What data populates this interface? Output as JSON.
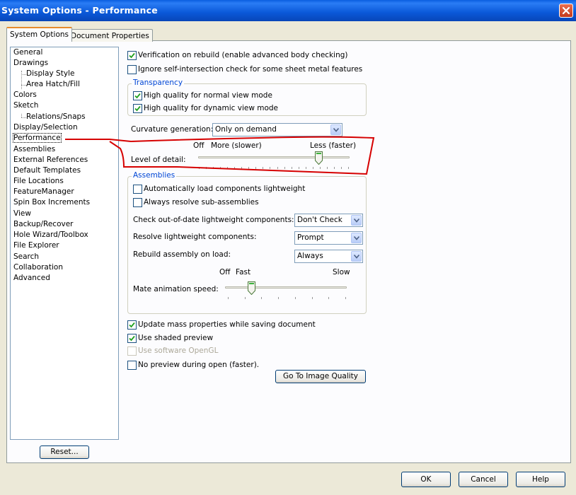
{
  "window": {
    "title": "System Options - Performance"
  },
  "tabs": [
    {
      "label": "System Options",
      "active": true
    },
    {
      "label": "Document Properties",
      "active": false
    }
  ],
  "tree": {
    "items": [
      {
        "label": "General",
        "level": 0
      },
      {
        "label": "Drawings",
        "level": 0
      },
      {
        "label": "Display Style",
        "level": 1
      },
      {
        "label": "Area Hatch/Fill",
        "level": 1
      },
      {
        "label": "Colors",
        "level": 0
      },
      {
        "label": "Sketch",
        "level": 0
      },
      {
        "label": "Relations/Snaps",
        "level": 1
      },
      {
        "label": "Display/Selection",
        "level": 0
      },
      {
        "label": "Performance",
        "level": 0,
        "selected": true
      },
      {
        "label": "Assemblies",
        "level": 0
      },
      {
        "label": "External References",
        "level": 0
      },
      {
        "label": "Default Templates",
        "level": 0
      },
      {
        "label": "File Locations",
        "level": 0
      },
      {
        "label": "FeatureManager",
        "level": 0
      },
      {
        "label": "Spin Box Increments",
        "level": 0
      },
      {
        "label": "View",
        "level": 0
      },
      {
        "label": "Backup/Recover",
        "level": 0
      },
      {
        "label": "Hole Wizard/Toolbox",
        "level": 0
      },
      {
        "label": "File Explorer",
        "level": 0
      },
      {
        "label": "Search",
        "level": 0
      },
      {
        "label": "Collaboration",
        "level": 0
      },
      {
        "label": "Advanced",
        "level": 0
      }
    ]
  },
  "reset_button": "Reset...",
  "options": {
    "verification": {
      "label": "Verification on rebuild (enable advanced body checking)",
      "checked": true
    },
    "ignore_self_intersection": {
      "label": "Ignore self-intersection check for some sheet metal features",
      "checked": false
    }
  },
  "transparency": {
    "title": "Transparency",
    "normal": {
      "label": "High quality for normal view mode",
      "checked": true
    },
    "dynamic": {
      "label": "High quality for dynamic view mode",
      "checked": true
    }
  },
  "curvature": {
    "label": "Curvature generation:",
    "value": "Only on demand"
  },
  "level_of_detail": {
    "label": "Level of detail:",
    "off_label": "Off",
    "more_label": "More (slower)",
    "less_label": "Less (faster)",
    "fraction": 0.8
  },
  "assemblies": {
    "title": "Assemblies",
    "auto_lightweight": {
      "label": "Automatically load components lightweight",
      "checked": false
    },
    "resolve_sub": {
      "label": "Always resolve sub-assemblies",
      "checked": false
    },
    "check_out_of_date": {
      "label": "Check out-of-date lightweight components:",
      "value": "Don't Check"
    },
    "resolve_lightweight": {
      "label": "Resolve lightweight components:",
      "value": "Prompt"
    },
    "rebuild_on_load": {
      "label": "Rebuild assembly on load:",
      "value": "Always"
    },
    "mate_animation": {
      "label": "Mate animation speed:",
      "off_label": "Off",
      "fast_label": "Fast",
      "slow_label": "Slow",
      "fraction": 0.2
    }
  },
  "more_options": {
    "update_mass": {
      "label": "Update mass properties while saving document",
      "checked": true
    },
    "shaded_preview": {
      "label": "Use shaded preview",
      "checked": true
    },
    "software_opengl": {
      "label": "Use software OpenGL",
      "checked": false,
      "disabled": true
    },
    "no_preview": {
      "label": "No preview during open (faster).",
      "checked": false
    }
  },
  "image_quality_button": "Go To Image Quality",
  "footer": {
    "ok": "OK",
    "cancel": "Cancel",
    "help": "Help"
  },
  "colors": {
    "annotation": "#d60000",
    "title_bar": "#0a58d8",
    "group_title": "#0046d5"
  }
}
